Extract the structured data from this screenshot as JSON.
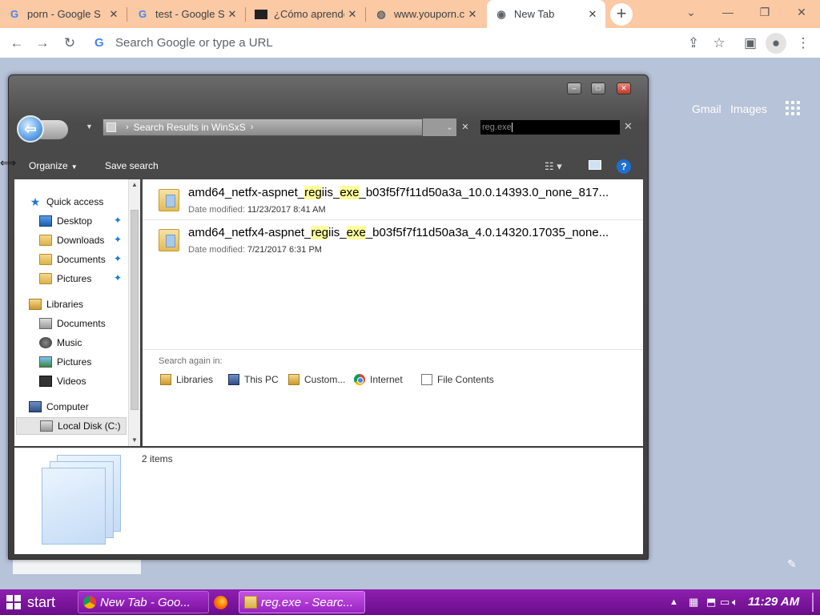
{
  "browser": {
    "tabs": [
      {
        "title": "porn - Google S",
        "favicon": "google-g"
      },
      {
        "title": "test - Google S",
        "favicon": "google-g"
      },
      {
        "title": "¿Cómo aprende",
        "favicon": "site-black"
      },
      {
        "title": "www.youporn.c",
        "favicon": "globe"
      },
      {
        "title": "New Tab",
        "favicon": "chrome"
      }
    ],
    "close_glyph": "✕",
    "new_tab_glyph": "+",
    "omnibox_placeholder": "Search Google or type a URL",
    "google_letter": "G"
  },
  "ntp": {
    "gmail": "Gmail",
    "images": "Images"
  },
  "explorer": {
    "breadcrumb": "Search Results in WinSxS",
    "search_query": "reg.exe",
    "commands": {
      "organize": "Organize",
      "save_search": "Save search"
    },
    "help_glyph": "?",
    "nav": {
      "quick_access": "Quick access",
      "desktop": "Desktop",
      "downloads": "Downloads",
      "documents": "Documents",
      "pictures": "Pictures",
      "libraries": "Libraries",
      "lib_documents": "Documents",
      "music": "Music",
      "lib_pictures": "Pictures",
      "videos": "Videos",
      "computer": "Computer",
      "local_disk": "Local Disk (C:)"
    },
    "results": [
      {
        "name_pre": "amd64_netfx-aspnet_",
        "name_hl1": "reg",
        "name_mid": "iis_",
        "name_hl2": "exe",
        "name_post": "_b03f5f7f11d50a3a_10.0.14393.0_none_817...",
        "meta_label": "Date modified:",
        "meta_value": "11/23/2017 8:41 AM"
      },
      {
        "name_pre": "amd64_netfx4-aspnet_",
        "name_hl1": "reg",
        "name_mid": "iis_",
        "name_hl2": "exe",
        "name_post": "_b03f5f7f11d50a3a_4.0.14320.17035_none...",
        "meta_label": "Date modified:",
        "meta_value": "7/21/2017 6:31 PM"
      }
    ],
    "search_again": {
      "label": "Search again in:",
      "items": [
        "Libraries",
        "This PC",
        "Custom...",
        "Internet",
        "File Contents"
      ]
    },
    "status_count": "2 items"
  },
  "taskbar": {
    "start": "start",
    "buttons": [
      "New Tab - Goo...",
      "reg.exe - Searc..."
    ],
    "clock": "11:29 AM"
  }
}
